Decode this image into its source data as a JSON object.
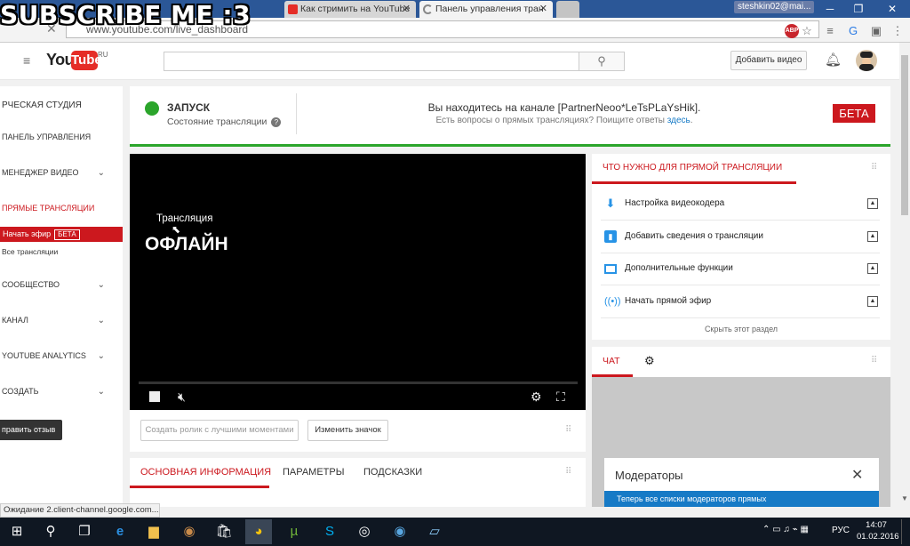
{
  "watermark": "SUBSCRIBE ME :3",
  "browser": {
    "tabs": [
      {
        "label": "Как стримить на YouTube"
      },
      {
        "label": "Панель управления тран"
      }
    ],
    "user_chip": "steshkin02@mai...",
    "url": "www.youtube.com/live_dashboard",
    "status_text": "Ожидание 2.client-channel.google.com...",
    "abp_label": "ABP"
  },
  "youtube": {
    "logo_you": "You",
    "logo_tube": "Tube",
    "logo_region": "RU",
    "upload_button": "Добавить видео"
  },
  "sidebar": {
    "studio": "РЧЕСКАЯ СТУДИЯ",
    "items": [
      {
        "label": "ПАНЕЛЬ УПРАВЛЕНИЯ"
      },
      {
        "label": "МЕНЕДЖЕР ВИДЕО"
      },
      {
        "label": "ПРЯМЫЕ ТРАНСЛЯЦИИ"
      },
      {
        "label": "Начать эфир"
      },
      {
        "label": "Все трансляции"
      },
      {
        "label": "СООБЩЕСТВО"
      },
      {
        "label": "КАНАЛ"
      },
      {
        "label": "YOUTUBE ANALYTICS"
      },
      {
        "label": "СОЗДАТЬ"
      }
    ],
    "live_badge": "БЕТА",
    "feedback": "править отзыв"
  },
  "status_panel": {
    "state": "ЗАПУСК",
    "state_sub": "Состояние трансляции",
    "channel_text": "Вы находитесь на канале [PartnerNeoo*LeTsPLaYsHik].",
    "question_text": "Есть вопросы о прямых трансляциях? Поищите ответы",
    "question_link": "здесь",
    "beta": "БЕТА"
  },
  "video": {
    "label": "Трансляция",
    "status": "ОФЛАЙН"
  },
  "actions": {
    "highlights_button": "Создать ролик с лучшими моментами",
    "thumbnail_button": "Изменить значок"
  },
  "info_tabs": [
    {
      "label": "ОСНОВНАЯ ИНФОРМАЦИЯ"
    },
    {
      "label": "ПАРАМЕТРЫ"
    },
    {
      "label": "ПОДСКАЗКИ"
    }
  ],
  "need_panel": {
    "title": "ЧТО НУЖНО ДЛЯ ПРЯМОЙ ТРАНСЛЯЦИИ",
    "items": [
      {
        "label": "Настройка видеокодера",
        "icon": "download-icon"
      },
      {
        "label": "Добавить сведения о трансляции",
        "icon": "stats-icon"
      },
      {
        "label": "Дополнительные функции",
        "icon": "card-icon"
      },
      {
        "label": "Начать прямой эфир",
        "icon": "broadcast-icon"
      }
    ],
    "hide_link": "Скрыть этот раздел"
  },
  "chat": {
    "tab": "ЧАТ",
    "moderators_title": "Модераторы",
    "moderators_text": "Теперь все списки модераторов прямых"
  },
  "taskbar": {
    "lang": "РУС",
    "time": "14:07",
    "date": "01.02.2016"
  },
  "colors": {
    "accent_red": "#cc181e",
    "status_green": "#2ba52b",
    "link_blue": "#167ac6"
  }
}
